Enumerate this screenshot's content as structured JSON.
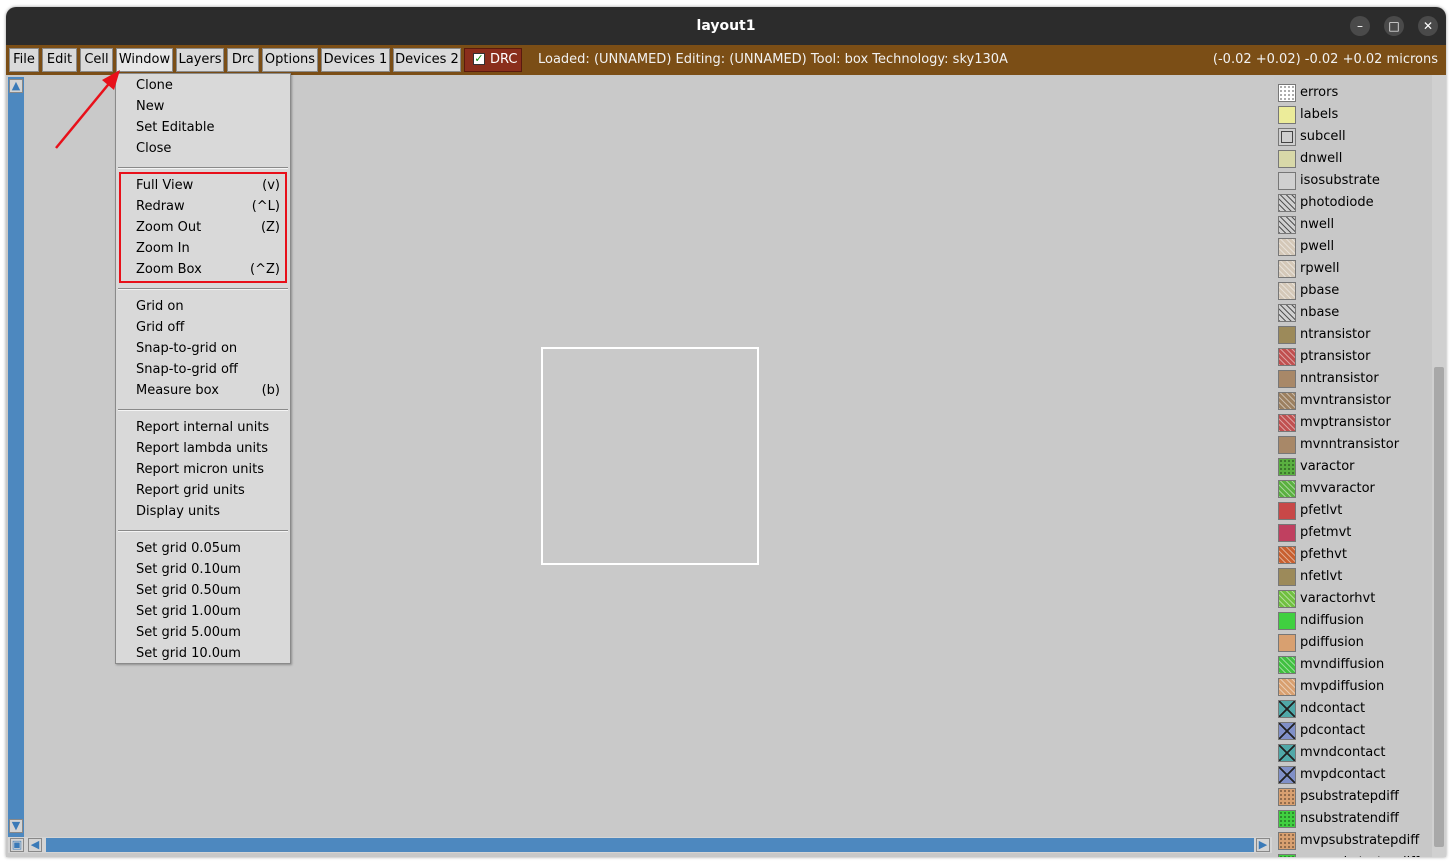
{
  "window": {
    "title": "layout1"
  },
  "menubar": {
    "items": [
      "File",
      "Edit",
      "Cell",
      "Window",
      "Layers",
      "Drc",
      "Options",
      "Devices 1",
      "Devices 2"
    ],
    "drc_label": "DRC",
    "status": "Loaded: (UNNAMED) Editing: (UNNAMED) Tool: box  Technology: sky130A",
    "coords": "(-0.02 +0.02) -0.02 +0.02 microns"
  },
  "window_menu": {
    "items": [
      {
        "label": "Clone",
        "key": ""
      },
      {
        "label": "New",
        "key": ""
      },
      {
        "label": "Set Editable",
        "key": ""
      },
      {
        "label": "Close",
        "key": ""
      },
      {
        "label": "Full View",
        "key": "(v)"
      },
      {
        "label": "Redraw",
        "key": "(^L)"
      },
      {
        "label": "Zoom Out",
        "key": "(Z)"
      },
      {
        "label": "Zoom In",
        "key": ""
      },
      {
        "label": "Zoom Box",
        "key": "(^Z)"
      },
      {
        "label": "Grid on",
        "key": ""
      },
      {
        "label": "Grid off",
        "key": ""
      },
      {
        "label": "Snap-to-grid on",
        "key": ""
      },
      {
        "label": "Snap-to-grid off",
        "key": ""
      },
      {
        "label": "Measure box",
        "key": "(b)"
      },
      {
        "label": "Report internal units",
        "key": ""
      },
      {
        "label": "Report lambda units",
        "key": ""
      },
      {
        "label": "Report micron units",
        "key": ""
      },
      {
        "label": "Report grid units",
        "key": ""
      },
      {
        "label": "Display units",
        "key": ""
      },
      {
        "label": "Set grid 0.05um",
        "key": ""
      },
      {
        "label": "Set grid 0.10um",
        "key": ""
      },
      {
        "label": "Set grid 0.50um",
        "key": ""
      },
      {
        "label": "Set grid 1.00um",
        "key": ""
      },
      {
        "label": "Set grid 5.00um",
        "key": ""
      },
      {
        "label": "Set grid 10.0um",
        "key": ""
      }
    ]
  },
  "layers": [
    {
      "name": "errors",
      "color": "#ffffff",
      "pattern": "dots"
    },
    {
      "name": "labels",
      "color": "#ecec9a",
      "pattern": "solid"
    },
    {
      "name": "subcell",
      "color": "#cfcfcf",
      "pattern": "box"
    },
    {
      "name": "dnwell",
      "color": "#d8d8a8",
      "pattern": "solid"
    },
    {
      "name": "isosubstrate",
      "color": "#d0d0d0",
      "pattern": "solid"
    },
    {
      "name": "photodiode",
      "color": "#d0d0d0",
      "pattern": "hatch"
    },
    {
      "name": "nwell",
      "color": "#d0d0d0",
      "pattern": "hatch"
    },
    {
      "name": "pwell",
      "color": "#d4c8b8",
      "pattern": "hatch-light"
    },
    {
      "name": "rpwell",
      "color": "#d4c8b8",
      "pattern": "hatch-light"
    },
    {
      "name": "pbase",
      "color": "#d4c8b8",
      "pattern": "hatch-light"
    },
    {
      "name": "nbase",
      "color": "#d0d0d0",
      "pattern": "hatch"
    },
    {
      "name": "ntransistor",
      "color": "#9c8a5a",
      "pattern": "solid"
    },
    {
      "name": "ptransistor",
      "color": "#c05050",
      "pattern": "hatch-light"
    },
    {
      "name": "nntransistor",
      "color": "#a88868",
      "pattern": "solid"
    },
    {
      "name": "mvntransistor",
      "color": "#9c8060",
      "pattern": "hatch-light"
    },
    {
      "name": "mvptransistor",
      "color": "#c05050",
      "pattern": "hatch-light"
    },
    {
      "name": "mvnntransistor",
      "color": "#a88868",
      "pattern": "solid"
    },
    {
      "name": "varactor",
      "color": "#5ab040",
      "pattern": "dots"
    },
    {
      "name": "mvvaractor",
      "color": "#5ab040",
      "pattern": "hatch-light"
    },
    {
      "name": "pfetlvt",
      "color": "#c84848",
      "pattern": "solid"
    },
    {
      "name": "pfetmvt",
      "color": "#c04060",
      "pattern": "solid"
    },
    {
      "name": "pfethvt",
      "color": "#c86030",
      "pattern": "hatch-light"
    },
    {
      "name": "nfetlvt",
      "color": "#9c8a5a",
      "pattern": "solid"
    },
    {
      "name": "varactorhvt",
      "color": "#70c040",
      "pattern": "hatch-light"
    },
    {
      "name": "ndiffusion",
      "color": "#40d040",
      "pattern": "solid"
    },
    {
      "name": "pdiffusion",
      "color": "#d8a070",
      "pattern": "solid"
    },
    {
      "name": "mvndiffusion",
      "color": "#40c040",
      "pattern": "hatch-light"
    },
    {
      "name": "mvpdiffusion",
      "color": "#d8a070",
      "pattern": "hatch-light"
    },
    {
      "name": "ndcontact",
      "color": "#50a8a8",
      "pattern": "cross"
    },
    {
      "name": "pdcontact",
      "color": "#8090c8",
      "pattern": "cross"
    },
    {
      "name": "mvndcontact",
      "color": "#50a8a8",
      "pattern": "cross"
    },
    {
      "name": "mvpdcontact",
      "color": "#8090c8",
      "pattern": "cross"
    },
    {
      "name": "psubstratepdiff",
      "color": "#d8a070",
      "pattern": "dots"
    },
    {
      "name": "nsubstratendiff",
      "color": "#40d040",
      "pattern": "dots"
    },
    {
      "name": "mvpsubstratepdiff",
      "color": "#d8a070",
      "pattern": "dots"
    },
    {
      "name": "mvnsubstratendiff",
      "color": "#40d040",
      "pattern": "dots"
    }
  ]
}
